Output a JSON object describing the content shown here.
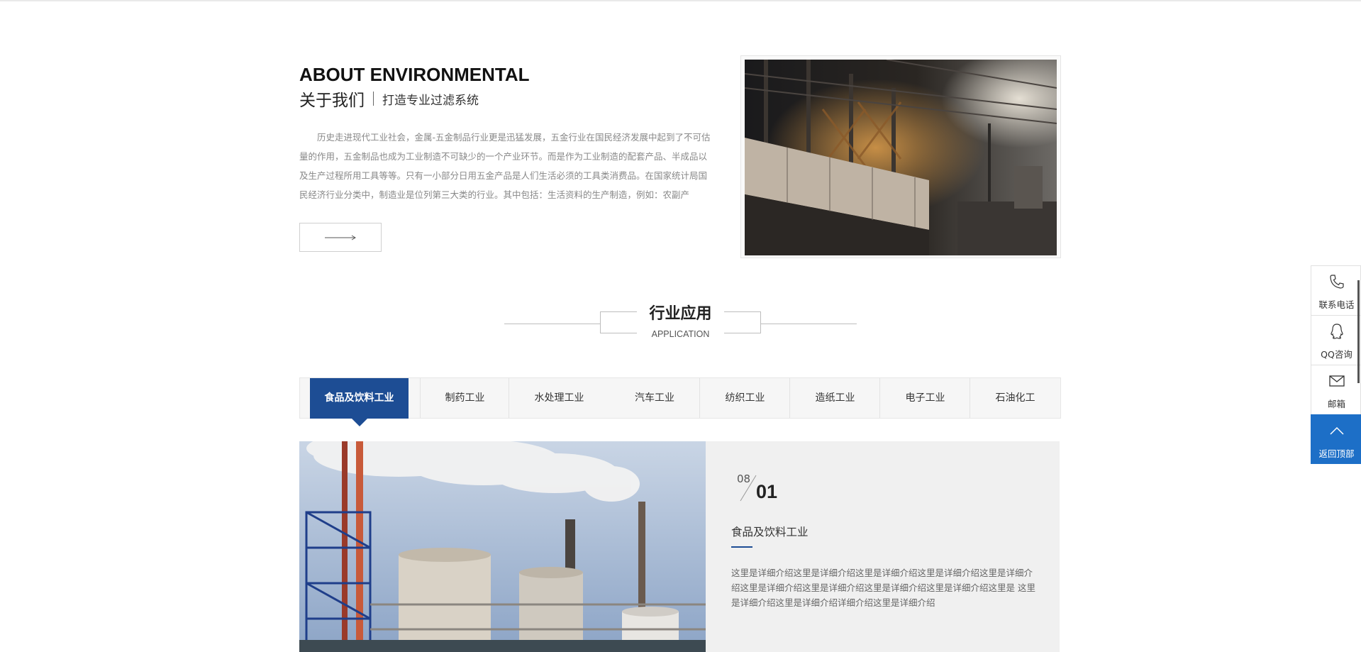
{
  "about": {
    "title": "ABOUT ENVIRONMENTAL",
    "subtitle_cn": "关于我们",
    "tagline": "打造专业过滤系统",
    "body": "历史走进现代工业社会，金属-五金制品行业更是迅猛发展，五金行业在国民经济发展中起到了不可估量的作用，五金制品也成为工业制造不可缺少的一个产业环节。而是作为工业制造的配套产品、半成品以及生产过程所用工具等等。只有一小部分日用五金产品是人们生活必须的工具类消费品。在国家统计局国民经济行业分类中，制造业是位列第三大类的行业。其中包括：生活资料的生产制造，例如：农副产",
    "more_icon": "arrow-right-icon"
  },
  "application": {
    "title": "行业应用",
    "subtitle": "APPLICATION"
  },
  "tabs": [
    {
      "label": "食品及饮料工业",
      "active": true
    },
    {
      "label": "制药工业",
      "active": false
    },
    {
      "label": "水处理工业",
      "active": false
    },
    {
      "label": "汽车工业",
      "active": false
    },
    {
      "label": "纺织工业",
      "active": false
    },
    {
      "label": "造纸工业",
      "active": false
    },
    {
      "label": "电子工业",
      "active": false
    },
    {
      "label": "石油化工",
      "active": false
    }
  ],
  "content": {
    "total": "08",
    "index": "01",
    "title": "食品及饮料工业",
    "description": "这里是详细介绍这里是详细介绍这里是详细介绍这里是详细介绍这里是详细介绍这里是详细介绍这里是详细介绍这里是详细介绍这里是详细介绍这里是 这里是详细介绍这里是详细介绍详细介绍这里是详细介绍"
  },
  "side_widget": [
    {
      "label": "联系电话",
      "icon": "phone-icon"
    },
    {
      "label": "QQ咨询",
      "icon": "qq-icon"
    },
    {
      "label": "邮箱",
      "icon": "mail-icon"
    },
    {
      "label": "返回顶部",
      "icon": "chevron-up-icon"
    }
  ],
  "colors": {
    "primary": "#1d4d94",
    "side_top": "#1d6fc7",
    "panel_bg": "#f0f0f0"
  }
}
